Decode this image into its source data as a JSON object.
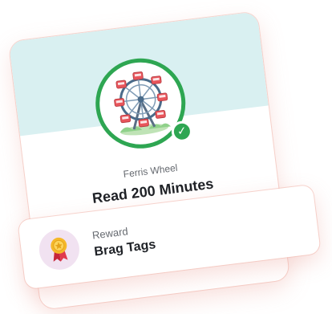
{
  "achievement": {
    "subtitle": "Ferris Wheel",
    "title": "Read 200 Minutes",
    "badge_icon": "ferris-wheel-icon",
    "status_icon": "checkmark-icon",
    "completed": true
  },
  "reward": {
    "label": "Reward",
    "value": "Brag Tags",
    "icon": "medal-icon"
  },
  "colors": {
    "accent_green": "#2ea652",
    "header_teal": "#d9f0f1",
    "reward_icon_bg": "#f1e2f1",
    "card_glow": "#e8968c"
  }
}
